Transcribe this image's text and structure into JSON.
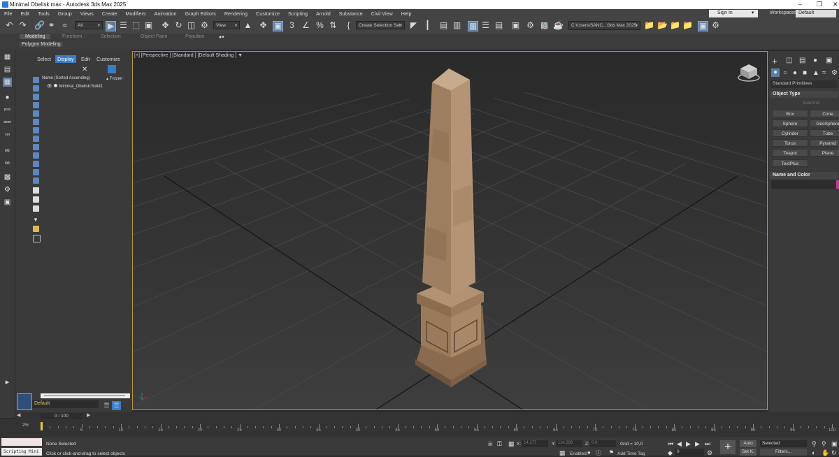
{
  "window": {
    "title": "Minimal Obelisk.max - Autodesk 3ds Max 2025",
    "minimize": "–",
    "restore": "❐",
    "close": "✕"
  },
  "menu": {
    "items": [
      "File",
      "Edit",
      "Tools",
      "Group",
      "Views",
      "Create",
      "Modifiers",
      "Animation",
      "Graph Editors",
      "Rendering",
      "Customize",
      "Scripting",
      "Arnold",
      "Substance",
      "Civil View",
      "Help"
    ],
    "sign_in": "Sign In",
    "workspaces_label": "Workspaces:",
    "workspace_value": "Default"
  },
  "toolbar": {
    "selection_filter": "All",
    "ref_coord": "View",
    "named_selection": "Create Selection Set",
    "project_path": "C:\\Users\\SANC...\\3ds Max 2025",
    "icons": [
      "undo-icon",
      "redo-icon",
      "link-icon",
      "unlink-icon",
      "bind-space-warp-icon",
      "select-object-icon",
      "select-by-name-icon",
      "rect-select-icon",
      "window-crossing-icon",
      "move-icon",
      "rotate-icon",
      "scale-icon",
      "select-manipulate-icon"
    ]
  },
  "ribbon": {
    "tabs": [
      "Modeling",
      "Freeform",
      "Selection",
      "Object Paint",
      "Populate"
    ],
    "panel_label": "Polygon Modeling"
  },
  "scene_explorer": {
    "tabs": [
      "Select",
      "Display",
      "Edit",
      "Customize"
    ],
    "active_tab": "Display",
    "column_header": "Name (Sorted Ascending)",
    "frozen_header": "▴ Frozen",
    "objects": [
      {
        "name": "Minimal_Obelisk:Solid1"
      }
    ],
    "layer": "Default"
  },
  "viewport": {
    "label": "[+] [Perspective ] [Standard ] [Default Shading ]",
    "accent_border": "#b89a3a"
  },
  "command_panel": {
    "category": "Standard Primitives",
    "object_type_title": "Object Type",
    "autogrid": "AutoGrid",
    "buttons": [
      "Box",
      "Cone",
      "Sphere",
      "GeoSphere",
      "Cylinder",
      "Tube",
      "Torus",
      "Pyramid",
      "Teapot",
      "Plane",
      "TextPlus"
    ],
    "name_color_title": "Name and Color"
  },
  "timeline": {
    "frame_display": "0 / 100",
    "percent": "2%",
    "ticks": [
      5,
      10,
      15,
      20,
      25,
      30,
      35,
      40,
      45,
      50,
      55,
      60,
      65,
      70,
      75,
      80,
      85,
      90,
      95,
      100
    ]
  },
  "status": {
    "maxscript_label": "Scripting Mini",
    "selection": "None Selected",
    "prompt": "Click or click-and-drag to select objects",
    "x_label": "X:",
    "x_value": "14.177",
    "y_label": "Y:",
    "y_value": "114.288",
    "z_label": "Z:",
    "z_value": "0.0",
    "grid": "Grid = 10,0",
    "enabled": "Enabled:",
    "add_time_tag": "Add Time Tag",
    "frame": "0",
    "auto": "Auto",
    "set_k": "Set K.",
    "selected": "Selected",
    "filters": "Filters..."
  }
}
